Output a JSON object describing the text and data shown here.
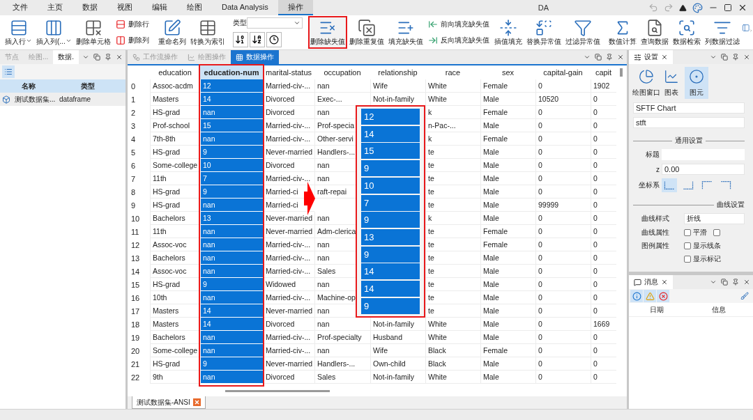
{
  "window": {
    "title": "DA"
  },
  "menu": [
    {
      "label": "文件",
      "selected": false
    },
    {
      "label": "主页",
      "selected": false
    },
    {
      "label": "数据",
      "selected": false
    },
    {
      "label": "视图",
      "selected": false
    },
    {
      "label": "编辑",
      "selected": false
    },
    {
      "label": "绘图",
      "selected": false
    },
    {
      "label": "Data Analysis",
      "selected": false
    },
    {
      "label": "操作",
      "selected": true
    }
  ],
  "ribbon": [
    {
      "items": [
        {
          "kind": "large",
          "label": "插入行",
          "dropdown": true,
          "outlined": false
        },
        {
          "kind": "large",
          "label": "插入列(...",
          "dropdown": true,
          "outlined": false
        },
        {
          "kind": "large",
          "label": "删除单元格",
          "dropdown": false,
          "outlined": false
        },
        {
          "kind": "stack",
          "items": [
            {
              "label": "删除行"
            },
            {
              "label": "删除列"
            }
          ]
        }
      ]
    },
    {
      "items": [
        {
          "kind": "large",
          "label": "重命名列",
          "dropdown": false,
          "outlined": false
        },
        {
          "kind": "large",
          "label": "转换为索引",
          "dropdown": false,
          "outlined": false
        }
      ]
    },
    {
      "items": [
        {
          "kind": "type-sort",
          "label": "类型"
        }
      ]
    },
    {
      "items": [
        {
          "kind": "large",
          "label": "删除缺失值",
          "dropdown": false,
          "outlined": true
        },
        {
          "kind": "large",
          "label": "删除重复值",
          "dropdown": false,
          "outlined": false
        },
        {
          "kind": "large",
          "label": "填充缺失值",
          "dropdown": false,
          "outlined": false
        },
        {
          "kind": "stack",
          "items": [
            {
              "label": "前向填充缺失值"
            },
            {
              "label": "反向填充缺失值"
            }
          ]
        },
        {
          "kind": "large",
          "label": "插值填充",
          "dropdown": false,
          "outlined": false
        },
        {
          "kind": "large",
          "label": "替换异常值",
          "dropdown": false,
          "outlined": false
        },
        {
          "kind": "large",
          "label": "过滤异常值",
          "dropdown": false,
          "outlined": false
        }
      ]
    },
    {
      "items": [
        {
          "kind": "large",
          "label": "数值计算",
          "dropdown": false,
          "outlined": false
        },
        {
          "kind": "large",
          "label": "查询数据",
          "dropdown": false,
          "outlined": false
        },
        {
          "kind": "large",
          "label": "数据检索",
          "dropdown": false,
          "outlined": false
        },
        {
          "kind": "large",
          "label": "列数据过滤",
          "dropdown": false,
          "outlined": false
        },
        {
          "kind": "cut"
        }
      ]
    }
  ],
  "left_panel": {
    "tabs": [
      {
        "label": "节点",
        "selected": false
      },
      {
        "label": "绘图...",
        "selected": false
      },
      {
        "label": "数据.",
        "selected": true
      }
    ],
    "columns": [
      "名称",
      "类型"
    ],
    "rows": [
      {
        "name": "测试数据集...",
        "type": "dataframe"
      }
    ]
  },
  "center": {
    "tabs": [
      {
        "label": "工作流操作",
        "selected": false
      },
      {
        "label": "绘图操作",
        "selected": false
      },
      {
        "label": "数据操作",
        "selected": true
      }
    ],
    "table": {
      "columns": [
        {
          "label": "education",
          "selected": false,
          "outlined": false
        },
        {
          "label": "education-num",
          "selected": true,
          "outlined": true
        },
        {
          "label": "marital-status",
          "selected": false,
          "outlined": false
        },
        {
          "label": "occupation",
          "selected": false,
          "outlined": false
        },
        {
          "label": "relationship",
          "selected": false,
          "outlined": false
        },
        {
          "label": "race",
          "selected": false,
          "outlined": false
        },
        {
          "label": "sex",
          "selected": false,
          "outlined": false
        },
        {
          "label": "capital-gain",
          "selected": false,
          "outlined": false
        },
        {
          "label": "capit",
          "selected": false,
          "outlined": false
        }
      ],
      "rows": [
        {
          "index": "0",
          "education": "Assoc-acdm",
          "education_num": "12",
          "marital_status": "Married-civ-...",
          "occupation": "nan",
          "relationship": "Wife",
          "race": "White",
          "sex": "Female",
          "capital_gain": "0",
          "capit": "1902"
        },
        {
          "index": "1",
          "education": "Masters",
          "education_num": "14",
          "marital_status": "Divorced",
          "occupation": "Exec-...",
          "relationship": "Not-in-family",
          "race": "White",
          "sex": "Male",
          "capital_gain": "10520",
          "capit": "0"
        },
        {
          "index": "2",
          "education": "HS-grad",
          "education_num": "nan",
          "marital_status": "Divorced",
          "occupation": "nan",
          "race": "k",
          "sex": "Female",
          "capital_gain": "0",
          "capit": "0"
        },
        {
          "index": "3",
          "education": "Prof-school",
          "education_num": "15",
          "marital_status": "Married-civ-...",
          "occupation": "Prof-specia",
          "race": "n-Pac-...",
          "sex": "Male",
          "capital_gain": "0",
          "capit": "0"
        },
        {
          "index": "4",
          "education": "7th-8th",
          "education_num": "nan",
          "marital_status": "Married-civ-...",
          "occupation": "Other-servi",
          "race": "k",
          "sex": "Female",
          "capital_gain": "0",
          "capit": "0"
        },
        {
          "index": "5",
          "education": "HS-grad",
          "education_num": "9",
          "marital_status": "Never-married",
          "occupation": "Handlers-...",
          "race": "te",
          "sex": "Male",
          "capital_gain": "0",
          "capit": "0"
        },
        {
          "index": "6",
          "education": "Some-college",
          "education_num": "10",
          "marital_status": "Divorced",
          "occupation": "nan",
          "race": "te",
          "sex": "Male",
          "capital_gain": "0",
          "capit": "0"
        },
        {
          "index": "7",
          "education": "11th",
          "education_num": "7",
          "marital_status": "Married-civ-...",
          "occupation": "nan",
          "race": "te",
          "sex": "Male",
          "capital_gain": "0",
          "capit": "0"
        },
        {
          "index": "8",
          "education": "HS-grad",
          "education_num": "9",
          "marital_status": "Married-ci",
          "occupation": "raft-repai",
          "race": "te",
          "sex": "Male",
          "capital_gain": "0",
          "capit": "0"
        },
        {
          "index": "9",
          "education": "HS-grad",
          "education_num": "nan",
          "marital_status": "Married-ci",
          "race": "te",
          "sex": "Male",
          "capital_gain": "99999",
          "capit": "0"
        },
        {
          "index": "10",
          "education": "Bachelors",
          "education_num": "13",
          "marital_status": "Never-married",
          "occupation": "nan",
          "race": "k",
          "sex": "Male",
          "capital_gain": "0",
          "capit": "0"
        },
        {
          "index": "11",
          "education": "11th",
          "education_num": "nan",
          "marital_status": "Never-married",
          "occupation": "Adm-clerica",
          "race": "te",
          "sex": "Female",
          "capital_gain": "0",
          "capit": "0"
        },
        {
          "index": "12",
          "education": "Assoc-voc",
          "education_num": "nan",
          "marital_status": "Married-civ-...",
          "occupation": "nan",
          "race": "te",
          "sex": "Female",
          "capital_gain": "0",
          "capit": "0"
        },
        {
          "index": "13",
          "education": "Bachelors",
          "education_num": "nan",
          "marital_status": "Married-civ-...",
          "occupation": "nan",
          "race": "te",
          "sex": "Male",
          "capital_gain": "0",
          "capit": "0"
        },
        {
          "index": "14",
          "education": "Assoc-voc",
          "education_num": "nan",
          "marital_status": "Married-civ-...",
          "occupation": "Sales",
          "race": "te",
          "sex": "Male",
          "capital_gain": "0",
          "capit": "0"
        },
        {
          "index": "15",
          "education": "HS-grad",
          "education_num": "9",
          "marital_status": "Widowed",
          "occupation": "nan",
          "race": "te",
          "sex": "Male",
          "capital_gain": "0",
          "capit": "0"
        },
        {
          "index": "16",
          "education": "10th",
          "education_num": "nan",
          "marital_status": "Married-civ-...",
          "occupation": "Machine-op",
          "race": "te",
          "sex": "Male",
          "capital_gain": "0",
          "capit": "0"
        },
        {
          "index": "17",
          "education": "Masters",
          "education_num": "14",
          "marital_status": "Never-married",
          "occupation": "nan",
          "race": "te",
          "sex": "Male",
          "capital_gain": "0",
          "capit": "0"
        },
        {
          "index": "18",
          "education": "Masters",
          "education_num": "14",
          "marital_status": "Divorced",
          "occupation": "nan",
          "relationship": "Not-in-family",
          "race": "White",
          "sex": "Male",
          "capital_gain": "0",
          "capit": "1669"
        },
        {
          "index": "19",
          "education": "Bachelors",
          "education_num": "nan",
          "marital_status": "Married-civ-...",
          "occupation": "Prof-specialty",
          "relationship": "Husband",
          "race": "White",
          "sex": "Male",
          "capital_gain": "0",
          "capit": "0"
        },
        {
          "index": "20",
          "education": "Some-college",
          "education_num": "nan",
          "marital_status": "Married-civ-...",
          "occupation": "nan",
          "relationship": "Wife",
          "race": "Black",
          "sex": "Female",
          "capital_gain": "0",
          "capit": "0"
        },
        {
          "index": "21",
          "education": "HS-grad",
          "education_num": "9",
          "marital_status": "Never-married",
          "occupation": "Handlers-...",
          "relationship": "Own-child",
          "race": "Black",
          "sex": "Male",
          "capital_gain": "0",
          "capit": "0"
        },
        {
          "index": "22",
          "education": "9th",
          "education_num": "nan",
          "marital_status": "Divorced",
          "occupation": "Sales",
          "relationship": "Not-in-family",
          "race": "White",
          "sex": "Male",
          "capital_gain": "0",
          "capit": "0"
        }
      ]
    },
    "result_popup": {
      "values": [
        "12",
        "14",
        "15",
        "9",
        "10",
        "7",
        "9",
        "13",
        "9",
        "14",
        "14",
        "9"
      ]
    },
    "sheet_tabs": [
      {
        "label": "测试数据集-ANSI",
        "selected": true
      }
    ]
  },
  "settings": {
    "tab": "设置",
    "modes": [
      {
        "label": "绘图窗口",
        "selected": false
      },
      {
        "label": "图表",
        "selected": false
      },
      {
        "label": "图元",
        "selected": true
      }
    ],
    "fields": [
      "SFTF Chart",
      "stft"
    ],
    "general": {
      "heading": "通用设置",
      "title_label": "标题",
      "z_label": "z",
      "z_value": "0.00",
      "axes_label": "坐标系",
      "axes": [
        {
          "selected": true
        },
        {
          "selected": false
        },
        {
          "selected": false
        },
        {
          "selected": false
        }
      ]
    },
    "curve": {
      "heading": "曲线设置",
      "style_label": "曲线样式",
      "style_value": "折线",
      "properties": [
        {
          "label": "曲线属性",
          "options": [
            {
              "label": "平滑",
              "checked": false
            },
            {
              "checked": false
            }
          ]
        },
        {
          "label": "图例属性",
          "options": [
            {
              "label": "显示线条",
              "checked": false
            }
          ]
        },
        {
          "options": [
            {
              "label": "显示标记",
              "checked": false
            }
          ]
        }
      ]
    }
  },
  "messages": {
    "tab": "消息",
    "filters": [
      {
        "kind": "info",
        "on": true
      },
      {
        "kind": "warning",
        "on": true
      },
      {
        "kind": "error",
        "on": true
      }
    ],
    "columns": [
      "日期",
      "信息"
    ]
  }
}
